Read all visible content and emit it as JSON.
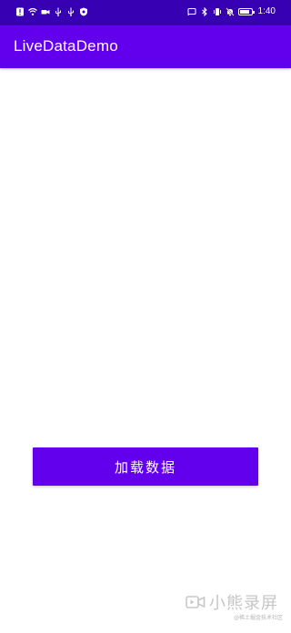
{
  "status_bar": {
    "time": "1:40",
    "background": "#3700b3",
    "left_icons": [
      "alert-icon",
      "wifi-icon",
      "camera-icon",
      "usb-icon",
      "usb-icon",
      "vpn-icon"
    ],
    "right_icons": [
      "cast-icon",
      "bluetooth-icon",
      "vibrate-icon",
      "mute-icon",
      "battery-icon"
    ]
  },
  "app_bar": {
    "title": "LiveDataDemo",
    "background": "#6200ee"
  },
  "main": {
    "load_button_label": "加载数据",
    "button_color": "#6200ee"
  },
  "watermark": {
    "brand": "小熊录屏",
    "credit": "@稀土掘金技术社区"
  }
}
